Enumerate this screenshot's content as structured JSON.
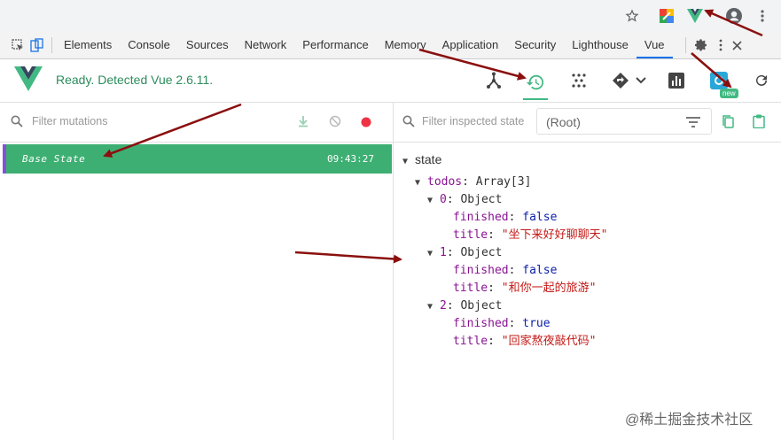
{
  "devtools": {
    "tabs": [
      "Elements",
      "Console",
      "Sources",
      "Network",
      "Performance",
      "Memory",
      "Application",
      "Security",
      "Lighthouse",
      "Vue"
    ],
    "active_tab": "Vue"
  },
  "vue_header": {
    "status": "Ready. Detected Vue 2.6.11.",
    "new_badge": "new"
  },
  "mutations": {
    "filter_placeholder": "Filter mutations",
    "items": [
      {
        "name": "Base State",
        "time": "09:43:27"
      }
    ]
  },
  "inspector": {
    "filter_placeholder": "Filter inspected state",
    "root_value": "(Root)",
    "state_label": "state",
    "todos_key": "todos",
    "todos_type": "Array[3]",
    "items": [
      {
        "index": "0",
        "type": "Object",
        "finished_key": "finished",
        "finished": "false",
        "title_key": "title",
        "title": "\"坐下来好好聊聊天\""
      },
      {
        "index": "1",
        "type": "Object",
        "finished_key": "finished",
        "finished": "false",
        "title_key": "title",
        "title": "\"和你一起的旅游\""
      },
      {
        "index": "2",
        "type": "Object",
        "finished_key": "finished",
        "finished": "true",
        "title_key": "title",
        "title": "\"回家熬夜敲代码\""
      }
    ]
  },
  "watermark": "@稀土掘金技术社区",
  "colors": {
    "vue_green": "#42b983",
    "mutation_bg": "#3daf72",
    "arrow": "#8b0f0f"
  }
}
